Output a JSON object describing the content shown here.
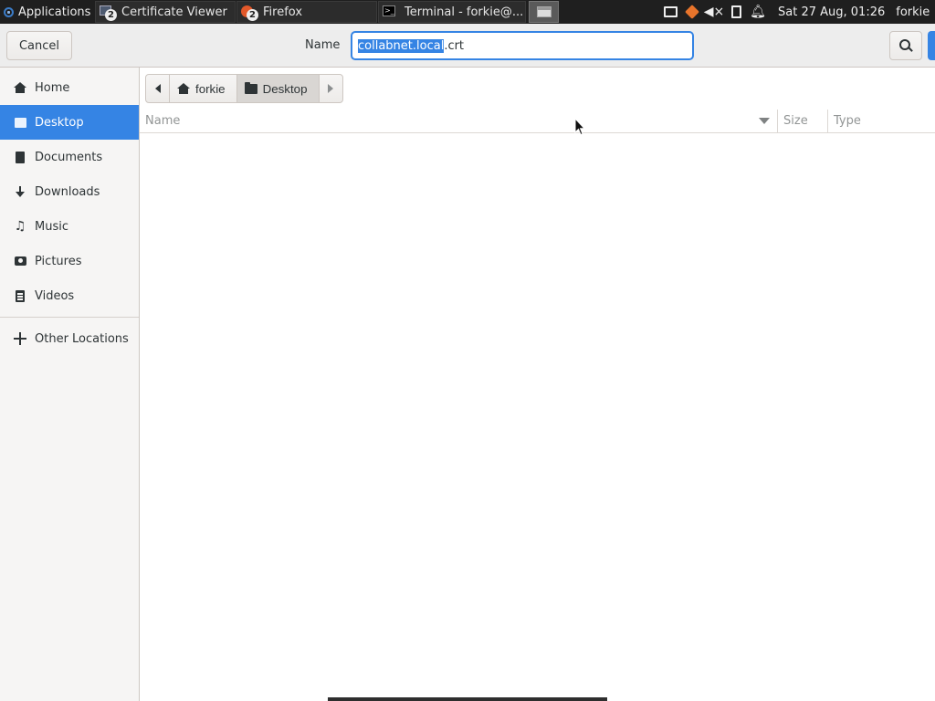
{
  "panel": {
    "applications_label": "Applications",
    "tasks": [
      {
        "label": "Certificate Viewer",
        "badge": "2"
      },
      {
        "label": "Firefox",
        "badge": "2"
      },
      {
        "label": "Terminal - forkie@..."
      }
    ],
    "clock": "Sat 27 Aug, 01:26",
    "user": "forkie"
  },
  "dialog": {
    "cancel_label": "Cancel",
    "name_label": "Name",
    "filename_selected": "collabnet.local",
    "filename_rest": ".crt"
  },
  "sidebar": {
    "items": [
      {
        "label": "Home",
        "icon": "home-icon"
      },
      {
        "label": "Desktop",
        "icon": "desktop-icon",
        "selected": true
      },
      {
        "label": "Documents",
        "icon": "documents-icon"
      },
      {
        "label": "Downloads",
        "icon": "downloads-icon"
      },
      {
        "label": "Music",
        "icon": "music-icon"
      },
      {
        "label": "Pictures",
        "icon": "pictures-icon"
      },
      {
        "label": "Videos",
        "icon": "videos-icon"
      }
    ],
    "other_locations": "Other Locations"
  },
  "pathbar": {
    "segments": [
      "forkie",
      "Desktop"
    ],
    "current": "Desktop"
  },
  "filelist": {
    "columns": [
      "Name",
      "Size",
      "Type"
    ],
    "sort_column": "Name",
    "sort_direction": "descending"
  },
  "colors": {
    "accent": "#3584e4",
    "panel_bg": "#1f1f1f",
    "sidebar_bg": "#f6f5f4"
  }
}
